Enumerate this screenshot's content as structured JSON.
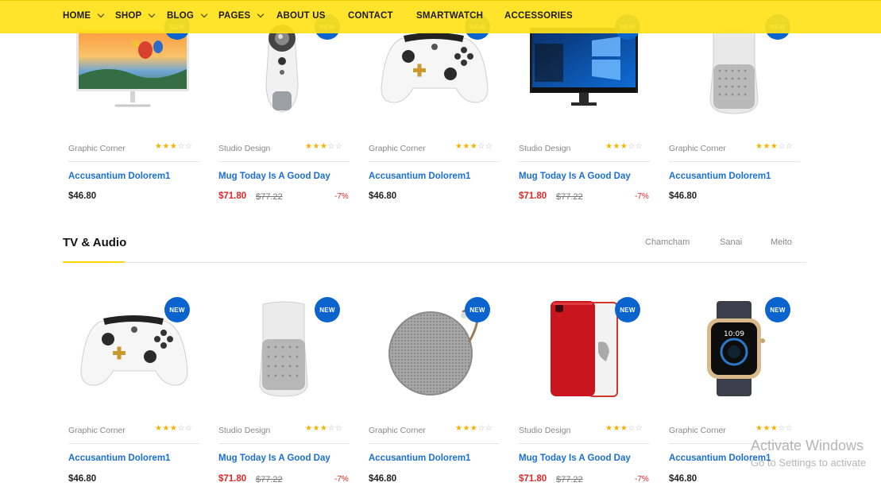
{
  "nav": {
    "items": [
      {
        "label": "HOME",
        "dropdown": true
      },
      {
        "label": "SHOP",
        "dropdown": true
      },
      {
        "label": "BLOG",
        "dropdown": true
      },
      {
        "label": "PAGES",
        "dropdown": true
      },
      {
        "label": "ABOUT US",
        "dropdown": false
      },
      {
        "label": "CONTACT",
        "dropdown": false
      },
      {
        "label": "SMARTWATCH",
        "dropdown": false
      },
      {
        "label": "ACCESSORIES",
        "dropdown": false
      }
    ]
  },
  "colors": {
    "nav_bg": "#ffe219",
    "badge": "#0b63ce",
    "link": "#1a6fd6",
    "sale": "#e32626",
    "accent": "#ffd600"
  },
  "top_row": [
    {
      "image": "monitor-landscape",
      "badge": "NEW",
      "vendor": "Graphic Corner",
      "rating": 3,
      "name": "Accusantium Dolorem1",
      "price": "$46.80",
      "old_price": "",
      "discount": ""
    },
    {
      "image": "360-camera",
      "badge": "NEW",
      "vendor": "Studio Design",
      "rating": 3,
      "name": "Mug Today Is A Good Day",
      "price": "$71.80",
      "old_price": "$77.22",
      "discount": "-7%"
    },
    {
      "image": "game-controller",
      "badge": "NEW",
      "vendor": "Graphic Corner",
      "rating": 3,
      "name": "Accusantium Dolorem1",
      "price": "$46.80",
      "old_price": "",
      "discount": ""
    },
    {
      "image": "windows-monitor",
      "badge": "NEW",
      "vendor": "Studio Design",
      "rating": 3,
      "name": "Mug Today Is A Good Day",
      "price": "$71.80",
      "old_price": "$77.22",
      "discount": "-7%"
    },
    {
      "image": "speaker",
      "badge": "NEW",
      "vendor": "Graphic Corner",
      "rating": 3,
      "name": "Accusantium Dolorem1",
      "price": "$46.80",
      "old_price": "",
      "discount": ""
    }
  ],
  "section": {
    "title": "TV & Audio",
    "tabs": [
      "Chamcham",
      "Sanai",
      "Meito"
    ]
  },
  "bottom_row": [
    {
      "image": "game-controller",
      "badge": "NEW",
      "vendor": "Graphic Corner",
      "rating": 3,
      "name": "Accusantium Dolorem1",
      "price": "$46.80",
      "old_price": "",
      "discount": ""
    },
    {
      "image": "speaker",
      "badge": "NEW",
      "vendor": "Studio Design",
      "rating": 3,
      "name": "Mug Today Is A Good Day",
      "price": "$71.80",
      "old_price": "$77.22",
      "discount": "-7%"
    },
    {
      "image": "round-speaker",
      "badge": "NEW",
      "vendor": "Graphic Corner",
      "rating": 3,
      "name": "Accusantium Dolorem1",
      "price": "$46.80",
      "old_price": "",
      "discount": ""
    },
    {
      "image": "red-phone",
      "badge": "NEW",
      "vendor": "Studio Design",
      "rating": 3,
      "name": "Mug Today Is A Good Day",
      "price": "$71.80",
      "old_price": "$77.22",
      "discount": "-7%"
    },
    {
      "image": "smartwatch",
      "badge": "NEW",
      "vendor": "Graphic Corner",
      "rating": 3,
      "name": "Accusantium Dolorem1",
      "price": "$46.80",
      "old_price": "",
      "discount": ""
    }
  ],
  "watermark": {
    "line1": "Activate Windows",
    "line2": "Go to Settings to activate"
  }
}
